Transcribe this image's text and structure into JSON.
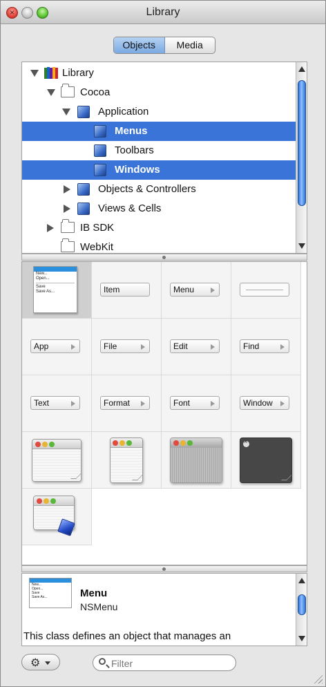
{
  "window": {
    "title": "Library"
  },
  "segmented": {
    "objects": "Objects",
    "media": "Media",
    "active": "Objects"
  },
  "tree": {
    "items": [
      {
        "label": "Library",
        "level": 0,
        "expanded": true,
        "icon": "library-books-icon",
        "selected": false
      },
      {
        "label": "Cocoa",
        "level": 1,
        "expanded": true,
        "icon": "folder-icon",
        "selected": false
      },
      {
        "label": "Application",
        "level": 2,
        "expanded": true,
        "icon": "cube-icon",
        "selected": false
      },
      {
        "label": "Menus",
        "level": 3,
        "icon": "cube-icon",
        "selected": true
      },
      {
        "label": "Toolbars",
        "level": 3,
        "icon": "cube-icon",
        "selected": false
      },
      {
        "label": "Windows",
        "level": 3,
        "icon": "cube-icon",
        "selected": true
      },
      {
        "label": "Objects & Controllers",
        "level": 2,
        "expanded": false,
        "icon": "cube-icon",
        "selected": false
      },
      {
        "label": "Views & Cells",
        "level": 2,
        "expanded": false,
        "icon": "cube-icon",
        "selected": false
      },
      {
        "label": "IB SDK",
        "level": 1,
        "expanded": false,
        "icon": "folder-icon",
        "selected": false
      },
      {
        "label": "WebKit",
        "level": 1,
        "icon": "folder-icon",
        "selected": false
      }
    ]
  },
  "grid": {
    "menu_preview": {
      "items": [
        "New...",
        "Open...",
        "Save",
        "Save As..."
      ]
    },
    "item": "Item",
    "menu": "Menu",
    "app": "App",
    "file": "File",
    "edit": "Edit",
    "find": "Find",
    "text": "Text",
    "format": "Format",
    "font": "Font",
    "window": "Window"
  },
  "detail": {
    "title": "Menu",
    "class_name": "NSMenu",
    "description": "This class defines an object that manages an"
  },
  "bottom": {
    "filter_placeholder": "Filter"
  },
  "colors": {
    "selection": "#3b74d9",
    "accent": "#2a6fd6"
  }
}
